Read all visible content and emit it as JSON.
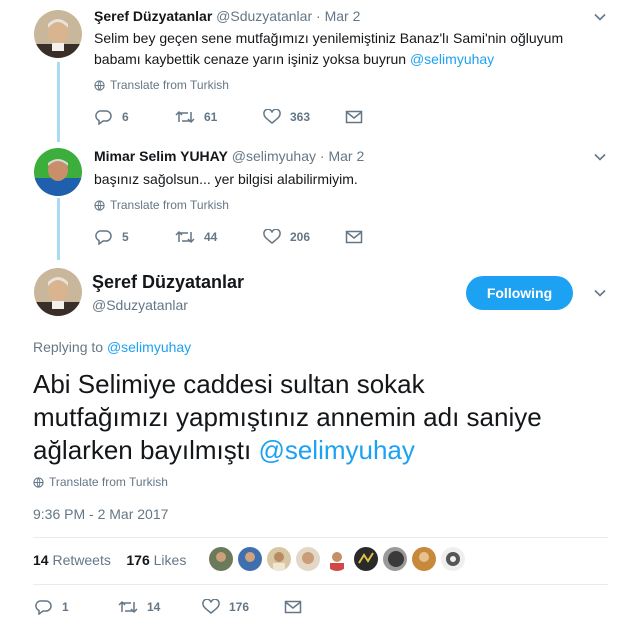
{
  "tweets": [
    {
      "name": "Şeref Düzyatanlar",
      "handle": "@Sduzyatanlar",
      "separator": "·",
      "date": "Mar 2",
      "text_before": "Selim bey geçen sene mutfağımızı yenilemiştiniz Banaz'lı Sami'nin oğluyum babamı kaybettik cenaze yarın işiniz yoksa buyrun ",
      "mention": "@selimyuhay",
      "translate": "Translate from Turkish",
      "replies": "6",
      "retweets": "61",
      "likes": "363"
    },
    {
      "name": "Mimar Selim YUHAY",
      "handle": "@selimyuhay",
      "separator": "·",
      "date": "Mar 2",
      "text": "başınız sağolsun... yer bilgisi alabilirmiyim.",
      "translate": "Translate from Turkish",
      "replies": "5",
      "retweets": "44",
      "likes": "206"
    }
  ],
  "main": {
    "name": "Şeref Düzyatanlar",
    "handle": "@Sduzyatanlar",
    "follow_label": "Following",
    "replying_prefix": "Replying to ",
    "replying_to": "@selimyuhay",
    "text_line1": "Abi Selimiye caddesi sultan sokak",
    "text_line2": "mutfağımızı yapmıştınız annemin adı saniye",
    "text_line3": "ağlarken bayılmıştı ",
    "mention": "@selimyuhay",
    "translate": "Translate from Turkish",
    "timestamp": "9:36 PM - 2 Mar 2017",
    "retweets_count": "14",
    "retweets_label": "Retweets",
    "likes_count": "176",
    "likes_label": "Likes",
    "replies": "1",
    "retweets": "14",
    "likes": "176"
  },
  "colors": {
    "accent": "#1da1f2",
    "muted": "#657786",
    "thread_line": "#a9dbf5"
  },
  "icons": [
    "globe-icon",
    "reply-icon",
    "retweet-icon",
    "heart-icon",
    "envelope-icon",
    "chevron-down-icon"
  ]
}
